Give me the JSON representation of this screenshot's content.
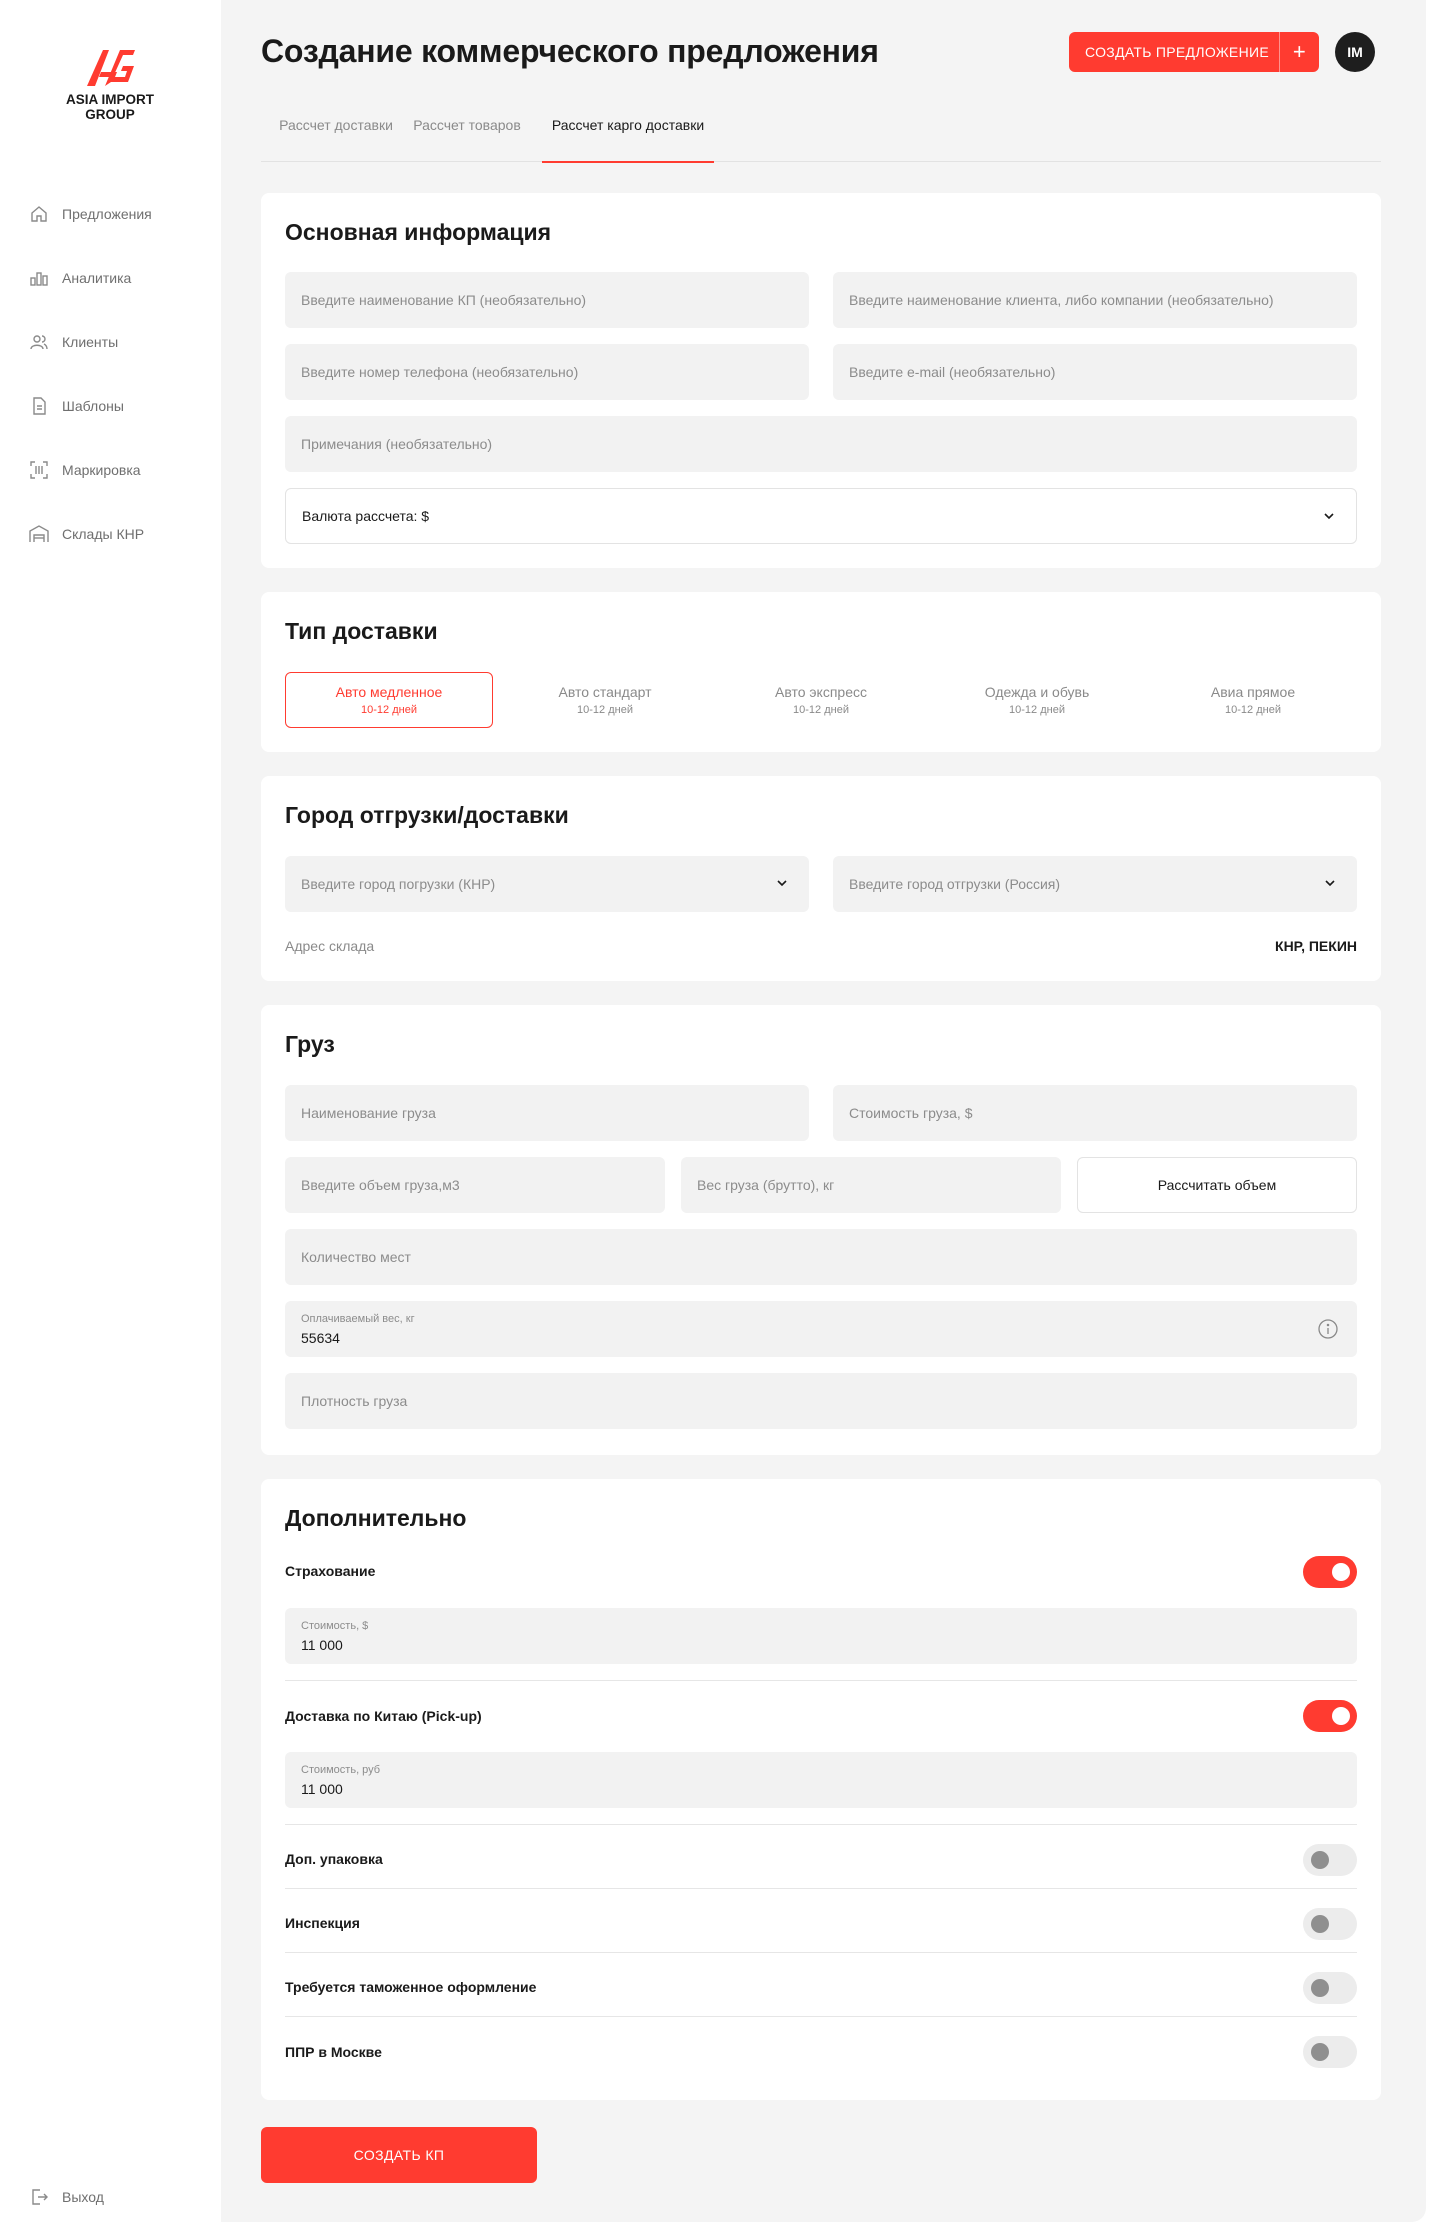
{
  "brand": {
    "name_line1": "ASIA IMPORT",
    "name_line2": "GROUP",
    "accent": "#ff3b30"
  },
  "sidebar": {
    "items": [
      {
        "label": "Предложения",
        "icon": "home-icon"
      },
      {
        "label": "Аналитика",
        "icon": "bar-chart-icon"
      },
      {
        "label": "Клиенты",
        "icon": "users-icon"
      },
      {
        "label": "Шаблоны",
        "icon": "document-icon"
      },
      {
        "label": "Маркировка",
        "icon": "barcode-scan-icon"
      },
      {
        "label": "Склады КНР",
        "icon": "warehouse-icon"
      }
    ],
    "logout": "Выход"
  },
  "header": {
    "title": "Создание коммерческого предложения",
    "create_button": "СОЗДАТЬ ПРЕДЛОЖЕНИЕ",
    "create_plus": "+",
    "avatar_initials": "IM"
  },
  "tabs": [
    {
      "label": "Рассчет доставки"
    },
    {
      "label": "Рассчет товаров"
    },
    {
      "label": "Рассчет карго доставки",
      "active": true
    }
  ],
  "basic_info": {
    "title": "Основная информация",
    "kp_name_placeholder": "Введите наименование КП (необязательно)",
    "client_placeholder": "Введите наименование клиента, либо компании (необязательно)",
    "phone_placeholder": "Введите номер телефона (необязательно)",
    "email_placeholder": "Введите e-mail (необязательно)",
    "notes_placeholder": "Примечания (необязательно)",
    "currency": "Валюта рассчета: $"
  },
  "delivery_type": {
    "title": "Тип доставки",
    "options": [
      {
        "name": "Авто медленное",
        "days": "10-12 дней",
        "active": true
      },
      {
        "name": "Авто стандарт",
        "days": "10-12 дней"
      },
      {
        "name": "Авто экспресс",
        "days": "10-12 дней"
      },
      {
        "name": "Одежда и обувь",
        "days": "10-12 дней"
      },
      {
        "name": "Авиа прямое",
        "days": "10-12 дней"
      }
    ]
  },
  "city": {
    "title": "Город отгрузки/доставки",
    "from_placeholder": "Введите город погрузки (КНР)",
    "to_placeholder": "Введите город отгрузки (Россия)",
    "warehouse_label": "Адрес склада",
    "warehouse_value": "КНР, ПЕКИН"
  },
  "cargo": {
    "title": "Груз",
    "name_placeholder": "Наименование груза",
    "cost_placeholder": "Стоимость груза, $",
    "volume_placeholder": "Введите объем груза,м3",
    "weight_placeholder": "Вес груза (брутто), кг",
    "calc_button": "Рассчитать объем",
    "places_placeholder": "Количество мест",
    "paid_weight_label": "Оплачиваемый вес, кг",
    "paid_weight_value": "55634",
    "density_placeholder": "Плотность груза"
  },
  "extra": {
    "title": "Дополнительно",
    "insurance": {
      "label": "Страхование",
      "on": true,
      "cost_label": "Стоимость, $",
      "cost_value": "11 000"
    },
    "pickup": {
      "label": "Доставка по Китаю (Pick-up)",
      "on": true,
      "cost_label": "Стоимость, руб",
      "cost_value": "11 000"
    },
    "packing": {
      "label": "Доп. упаковка",
      "on": false
    },
    "inspection": {
      "label": "Инспекция",
      "on": false
    },
    "customs": {
      "label": "Требуется таможенное оформление",
      "on": false
    },
    "ppr": {
      "label": "ППР в Москве",
      "on": false
    }
  },
  "submit": "СОЗДАТЬ КП"
}
